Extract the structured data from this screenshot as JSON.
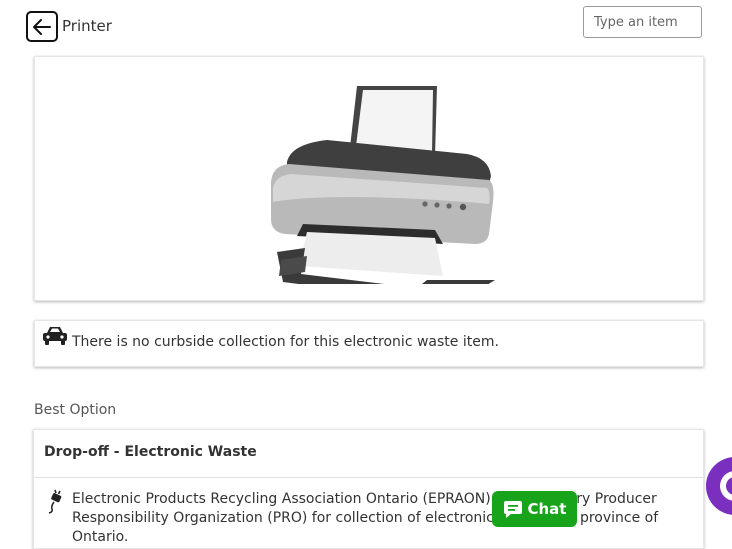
{
  "header": {
    "title": "Printer",
    "back_icon": "arrow-left-icon"
  },
  "search": {
    "placeholder": "Type an item"
  },
  "image_card": {
    "image_icon": "printer-image"
  },
  "notice": {
    "icon": "car-icon",
    "text": "There is no curbside collection for this electronic waste item."
  },
  "best_option": {
    "heading": "Best Option",
    "title": "Drop-off - Electronic Waste",
    "icon": "plug-icon",
    "description": "Electronic Products Recycling Association Ontario (EPRAON) is an Industry Producer Responsibility Organization (PRO) for collection of electronics within the province of Ontario."
  },
  "chat": {
    "label": "Chat",
    "icon": "chat-bubble-icon",
    "color": "#17a31a"
  },
  "help_fab": {
    "icon": "help-circle-icon",
    "color": "#7b2fbf"
  }
}
